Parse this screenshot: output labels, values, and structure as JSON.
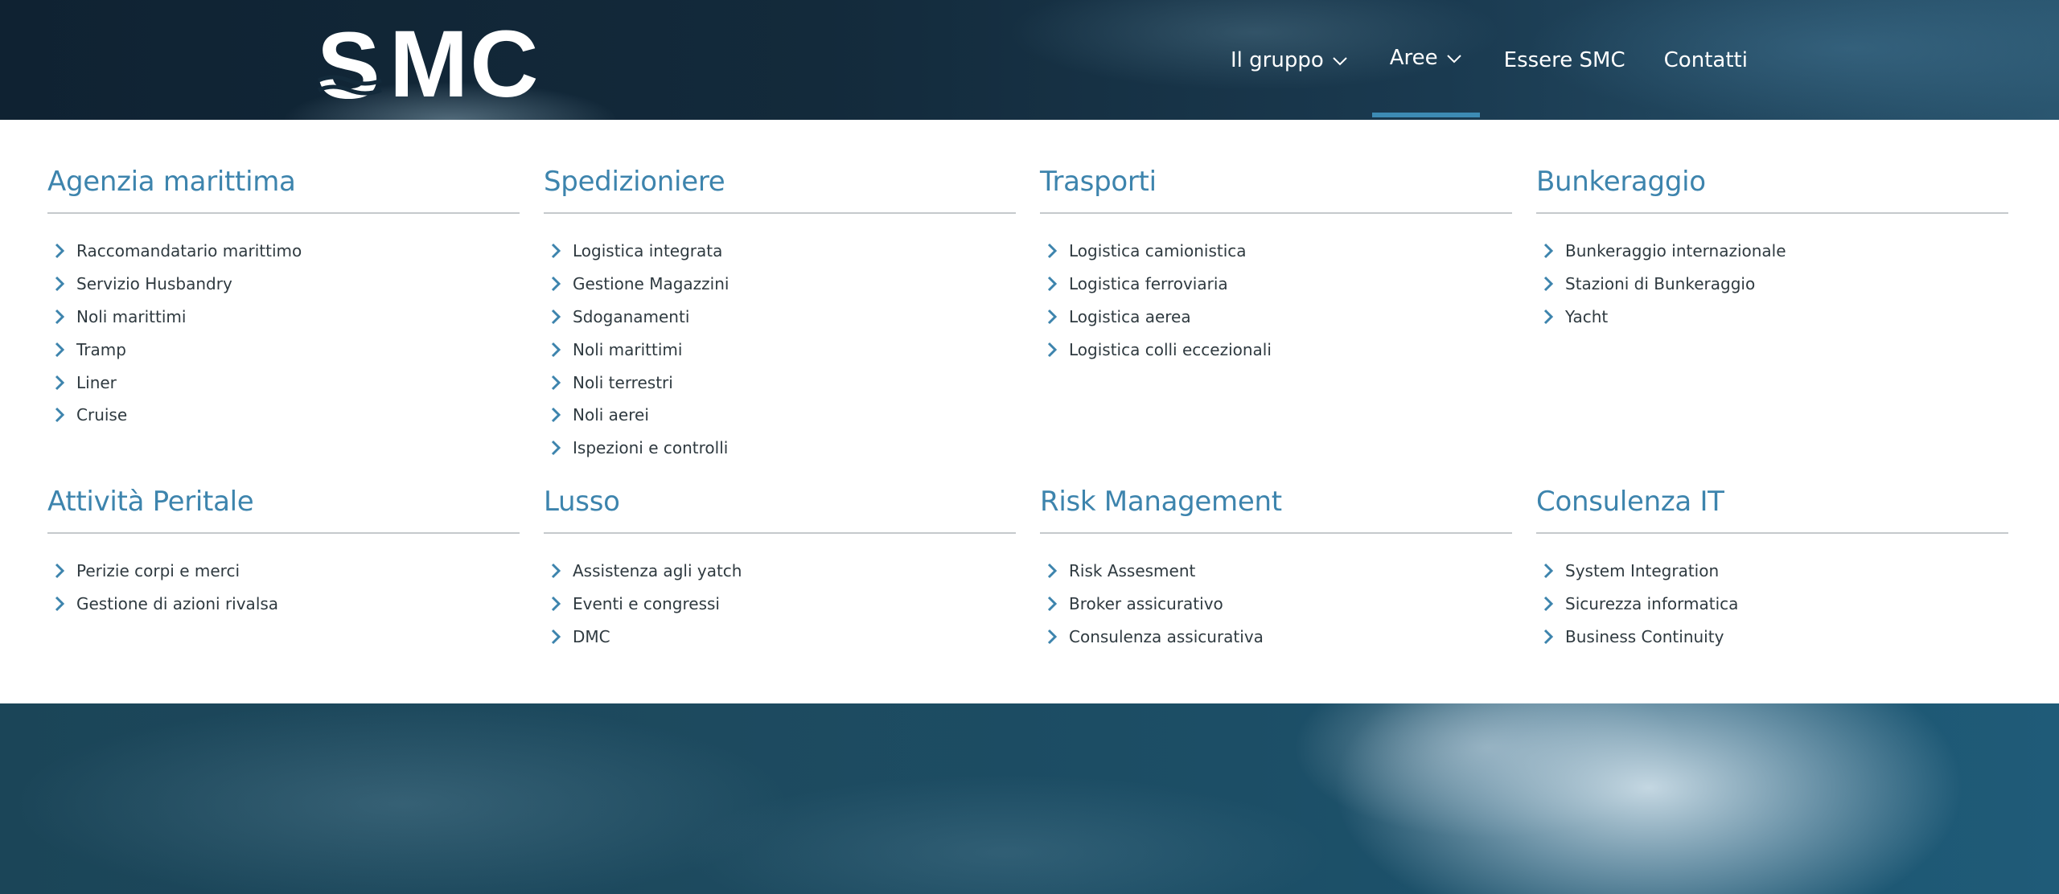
{
  "brand": {
    "name": "SMC",
    "logo_letter": "S",
    "logo_rest": "MC"
  },
  "nav": [
    {
      "label": "Il gruppo",
      "has_dropdown": true,
      "active": false
    },
    {
      "label": "Aree",
      "has_dropdown": true,
      "active": true
    },
    {
      "label": "Essere SMC",
      "has_dropdown": false,
      "active": false
    },
    {
      "label": "Contatti",
      "has_dropdown": false,
      "active": false
    }
  ],
  "colors": {
    "accent": "#3d84ad",
    "active_bar": "#3d8bb4",
    "text": "#2f3a40",
    "divider": "#c5c9cc"
  },
  "menu": {
    "sections": [
      {
        "title": "Agenzia marittima",
        "items": [
          "Raccomandatario marittimo",
          "Servizio Husbandry",
          "Noli marittimi",
          "Tramp",
          "Liner",
          "Cruise"
        ]
      },
      {
        "title": "Spedizioniere",
        "items": [
          "Logistica integrata",
          "Gestione Magazzini",
          "Sdoganamenti",
          "Noli marittimi",
          "Noli terrestri",
          "Noli aerei",
          "Ispezioni e controlli"
        ]
      },
      {
        "title": "Trasporti",
        "items": [
          "Logistica camionistica",
          "Logistica ferroviaria",
          "Logistica aerea",
          "Logistica colli eccezionali"
        ]
      },
      {
        "title": "Bunkeraggio",
        "items": [
          "Bunkeraggio internazionale",
          "Stazioni di Bunkeraggio",
          "Yacht"
        ]
      },
      {
        "title": "Attività Peritale",
        "items": [
          "Perizie corpi e merci",
          "Gestione di azioni rivalsa"
        ]
      },
      {
        "title": "Lusso",
        "items": [
          "Assistenza agli yatch",
          "Eventi e congressi",
          "DMC"
        ]
      },
      {
        "title": "Risk Management",
        "items": [
          "Risk Assesment",
          "Broker assicurativo",
          "Consulenza assicurativa"
        ]
      },
      {
        "title": "Consulenza IT",
        "items": [
          "System Integration",
          "Sicurezza informatica",
          "Business Continuity"
        ]
      }
    ]
  }
}
